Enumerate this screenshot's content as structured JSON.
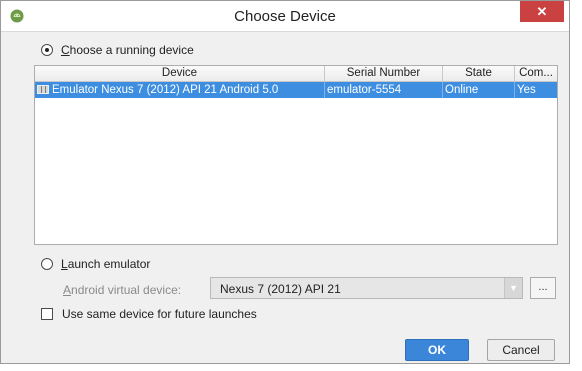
{
  "window": {
    "title": "Choose Device",
    "close_label": "✕"
  },
  "running_option": {
    "label_mnemonic": "C",
    "label_rest": "hoose a running device",
    "selected": true
  },
  "device_table": {
    "columns": [
      "Device",
      "Serial Number",
      "State",
      "Com..."
    ],
    "rows": [
      {
        "device": "Emulator Nexus 7 (2012) API 21 Android 5.0",
        "serial": "emulator-5554",
        "state": "Online",
        "compatible": "Yes",
        "selected": true
      }
    ]
  },
  "launch_option": {
    "label_mnemonic": "L",
    "label_rest": "aunch emulator",
    "selected": false
  },
  "avd": {
    "label_mnemonic": "A",
    "label_rest": "ndroid virtual device:",
    "value": "Nexus 7 (2012) API 21",
    "more_label": "..."
  },
  "future_launches": {
    "label": "Use same device for future launches",
    "checked": false
  },
  "buttons": {
    "ok": "OK",
    "cancel": "Cancel"
  },
  "colors": {
    "selection": "#3d8ee0",
    "ok_button": "#3b86d8",
    "close_button": "#c94141"
  }
}
